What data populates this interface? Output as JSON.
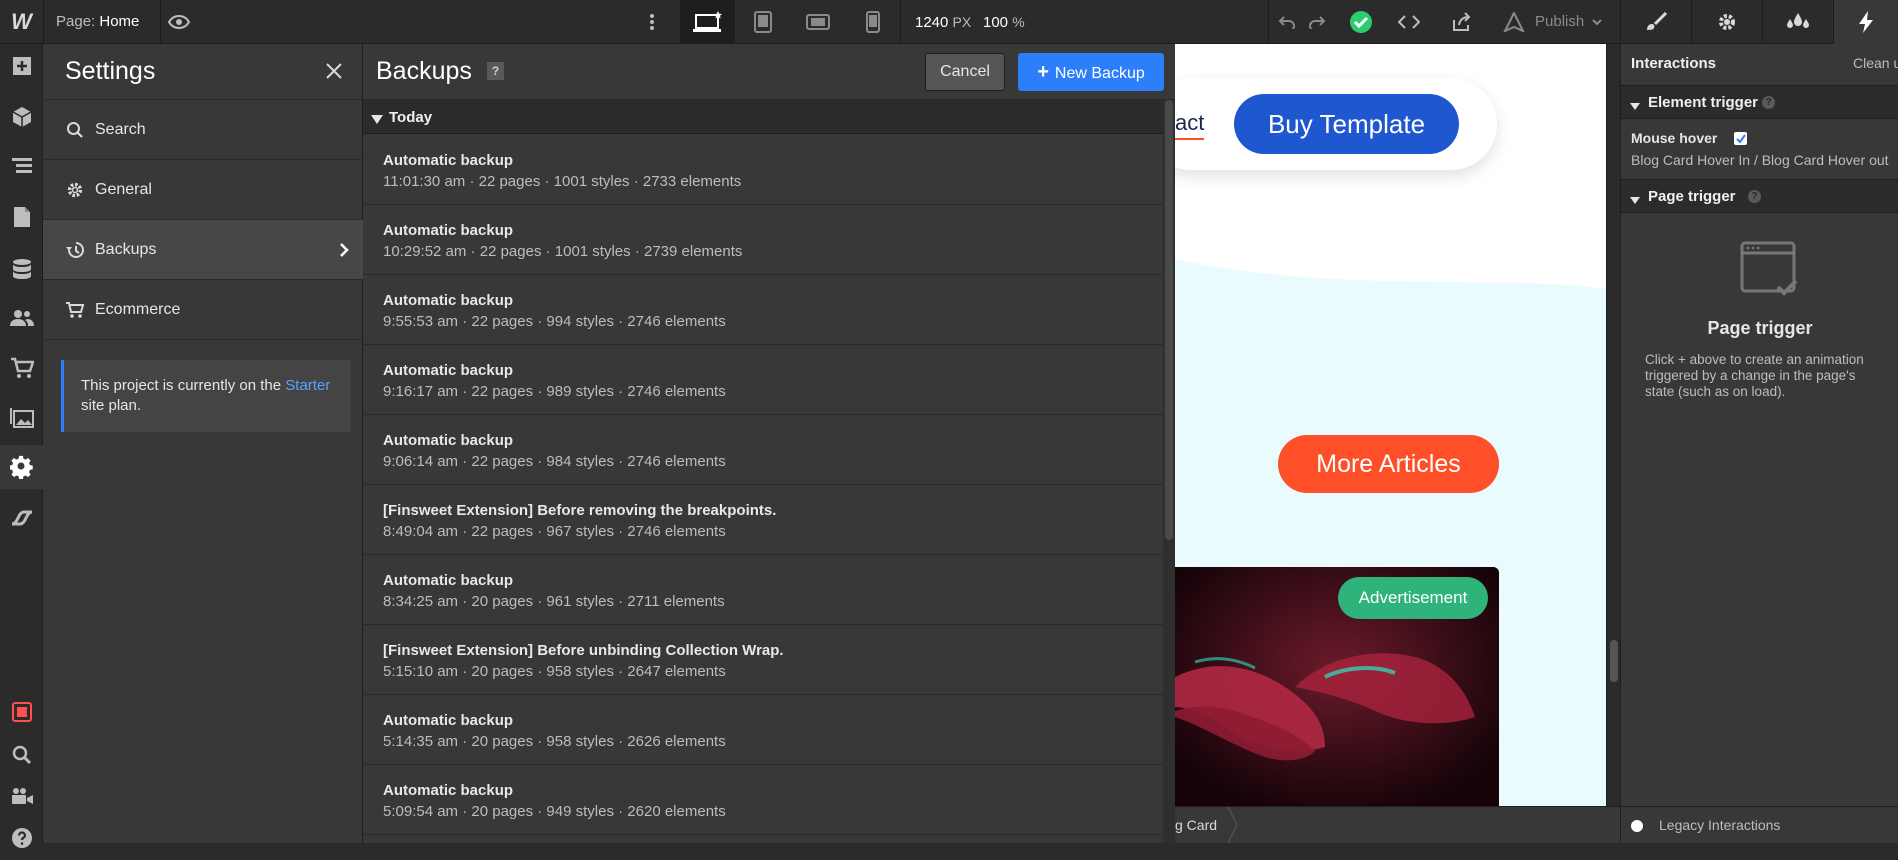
{
  "topbar": {
    "logo": "W",
    "page_label": "Page:",
    "page_name": "Home",
    "width_value": "1240",
    "width_unit": "PX",
    "zoom_value": "100",
    "zoom_unit": "%",
    "publish_label": "Publish"
  },
  "settings": {
    "title": "Settings",
    "items": [
      {
        "label": "Search",
        "icon": "search-icon"
      },
      {
        "label": "General",
        "icon": "gear-icon"
      },
      {
        "label": "Backups",
        "icon": "history-icon"
      },
      {
        "label": "Ecommerce",
        "icon": "cart-icon"
      }
    ],
    "plan_note_pre": "This project is currently on the",
    "plan_link": "Starter",
    "plan_note_post": "site plan."
  },
  "backups": {
    "title": "Backups",
    "help": "?",
    "cancel_label": "Cancel",
    "new_label": "New Backup",
    "group_label": "Today",
    "rows": [
      {
        "title": "Automatic backup",
        "meta": "11:01:30 am · 22 pages · 1001 styles · 2733 elements"
      },
      {
        "title": "Automatic backup",
        "meta": "10:29:52 am · 22 pages · 1001 styles · 2739 elements"
      },
      {
        "title": "Automatic backup",
        "meta": "9:55:53 am · 22 pages · 994 styles · 2746 elements"
      },
      {
        "title": "Automatic backup",
        "meta": "9:16:17 am · 22 pages · 989 styles · 2746 elements"
      },
      {
        "title": "Automatic backup",
        "meta": "9:06:14 am · 22 pages · 984 styles · 2746 elements"
      },
      {
        "title": "[Finsweet Extension] Before removing the breakpoints.",
        "meta": "8:49:04 am · 22 pages · 967 styles · 2746 elements"
      },
      {
        "title": "Automatic backup",
        "meta": "8:34:25 am · 20 pages · 961 styles · 2711 elements"
      },
      {
        "title": "[Finsweet Extension] Before unbinding Collection Wrap.",
        "meta": "5:15:10 am · 20 pages · 958 styles · 2647 elements"
      },
      {
        "title": "Automatic backup",
        "meta": "5:14:35 am · 20 pages · 958 styles · 2626 elements"
      },
      {
        "title": "Automatic backup",
        "meta": "5:09:54 am · 20 pages · 949 styles · 2620 elements"
      }
    ]
  },
  "canvas": {
    "nav_link_partial": "act",
    "buy_button": "Buy Template",
    "more_button": "More Articles",
    "ad_badge": "Advertisement",
    "breadcrumb": "g Card"
  },
  "interactions": {
    "title": "Interactions",
    "clean_label": "Clean u",
    "element_trigger": "Element trigger",
    "mouse_hover_label": "Mouse hover",
    "mouse_hover_checked": true,
    "hover_desc": "Blog Card Hover In / Blog Card Hover out",
    "page_trigger": "Page trigger",
    "page_trigger_heading": "Page trigger",
    "page_trigger_desc": "Click + above to create an animation triggered by a change in the page's state (such as on load).",
    "legacy_label": "Legacy Interactions"
  },
  "colors": {
    "accent": "#2d7ff9",
    "success": "#2ecc71",
    "canvas_blue": "#1f57d0",
    "canvas_orange": "#ff4f29",
    "canvas_green": "#2fb37b"
  }
}
